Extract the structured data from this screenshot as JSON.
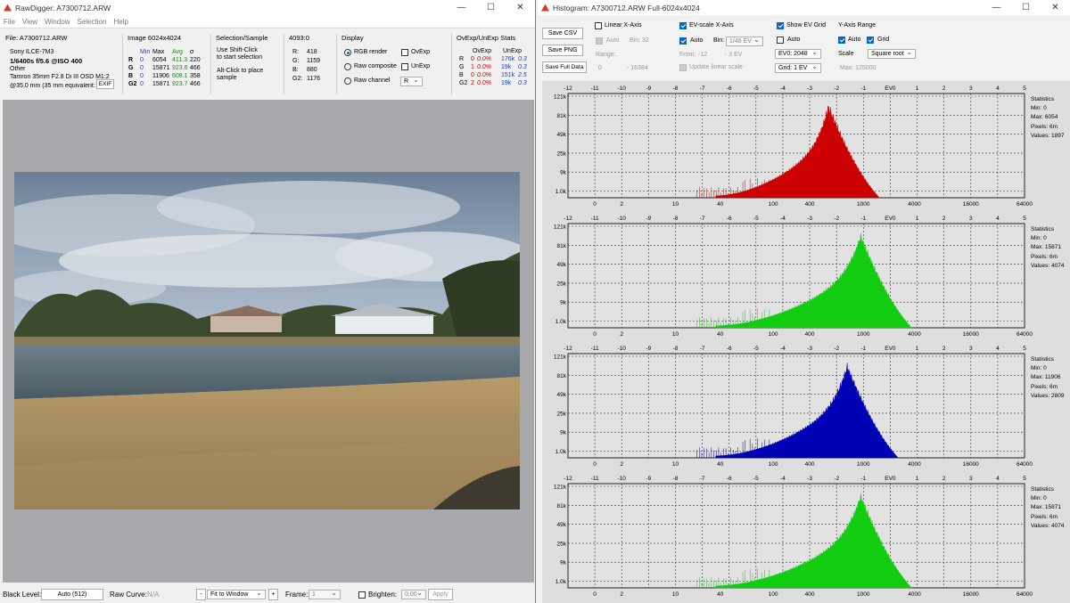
{
  "left_window": {
    "title": "RawDigger: A7300712.ARW",
    "menu": [
      "File",
      "View",
      "Window",
      "Selection",
      "Help"
    ],
    "file": {
      "label": "File: A7300712.ARW",
      "camera": "Sony ILCE-7M3",
      "exposure": "1/6400s f/5.6 @ISO 400",
      "mode": "Other",
      "lens": "Tamron 35mm F2.8 Di III OSD M1:2",
      "focal": "@35.0 mm (35 mm equivalent: ",
      "exif_button": "EXIF"
    },
    "image": {
      "label": "Image 6024x4024",
      "headers": [
        "Min",
        "Max",
        "Avg",
        "σ"
      ],
      "rows": [
        {
          "ch": "R",
          "min": "0",
          "max": "6054",
          "avg": "411.3",
          "sd": "220"
        },
        {
          "ch": "G",
          "min": "0",
          "max": "15871",
          "avg": "923.6",
          "sd": "466"
        },
        {
          "ch": "B",
          "min": "0",
          "max": "11906",
          "avg": "608.1",
          "sd": "358"
        },
        {
          "ch": "G2",
          "min": "0",
          "max": "15871",
          "avg": "923.7",
          "sd": "466"
        }
      ]
    },
    "selection": {
      "label": "Selection/Sample",
      "line1": "Use Shift-Click",
      "line2": "to start selection",
      "line3": "Alt-Click to place",
      "line4": "sample"
    },
    "coords": {
      "label": "4093:0",
      "rows": [
        {
          "ch": "R:",
          "v": "418"
        },
        {
          "ch": "G:",
          "v": "1159"
        },
        {
          "ch": "B:",
          "v": "880"
        },
        {
          "ch": "G2:",
          "v": "1176"
        }
      ]
    },
    "display": {
      "label": "Display",
      "rgb_render": "RGB render",
      "raw_composite": "Raw composite",
      "raw_channel": "Raw channel",
      "ovexp": "OvExp",
      "unexp": "UnExp",
      "channel_value": "R"
    },
    "ovstats": {
      "label": "OvExp/UnExp Stats",
      "headers": [
        "OvExp",
        "UnExp"
      ],
      "rows": [
        {
          "ch": "R",
          "n": "0",
          "pct": "0.0%",
          "un": "176k",
          "unp": "0.3"
        },
        {
          "ch": "G",
          "n": "1",
          "pct": "0.0%",
          "un": "19k",
          "unp": "0.3"
        },
        {
          "ch": "B",
          "n": "0",
          "pct": "0.0%",
          "un": "151k",
          "unp": "2.5"
        },
        {
          "ch": "G2",
          "n": "2",
          "pct": "0.0%",
          "un": "19k",
          "unp": "0.3"
        }
      ]
    },
    "status": {
      "black_level_label": "Black Level:",
      "black_level_value": "Auto (512)",
      "raw_curve_label": "Raw Curve:",
      "raw_curve_value": "N/A",
      "minus": "-",
      "zoom": "Fit to Window",
      "plus": "+",
      "frame_label": "Frame:",
      "frame_value": "1",
      "brighten_label": "Brighten:",
      "brighten_value": "0.00",
      "apply": "Apply"
    }
  },
  "right_window": {
    "title": "Histogram: A7300712.ARW Full-6024x4024",
    "buttons": {
      "save_csv": "Save CSV",
      "save_png": "Save PNG",
      "save_full": "Save Full Data"
    },
    "linear": {
      "label": "Linear X-Axis",
      "auto": "Auto",
      "bin": "Bin: 32",
      "range": "Range:",
      "from": "0",
      "to": "- 16384"
    },
    "evscale": {
      "label": "EV-scale X-Axis",
      "auto": "Auto",
      "bin_label": "Bin:",
      "bin_value": "1/48 EV",
      "from_label": "From:",
      "from_value": "-12",
      "to_value": "- 3 EV",
      "update": "Update linear scale"
    },
    "evgrid": {
      "label": "Show EV Grid",
      "auto": "Auto",
      "ev0": "EV0: 2048",
      "grid": "Grid: 1 EV"
    },
    "yaxis": {
      "label": "Y-Axis Range",
      "auto": "Auto",
      "grid": "Grid",
      "scale_label": "Scale",
      "scale_value": "Square root",
      "max": "Max: 125000"
    },
    "ev_ticks": [
      "-12",
      "-11",
      "-10",
      "-9",
      "-8",
      "-7",
      "-6",
      "-5",
      "-4",
      "-3",
      "-2",
      "-1",
      "EV0",
      "1",
      "2",
      "3",
      "4",
      "5"
    ],
    "lin_ticks": [
      "0",
      "2",
      "10",
      "40",
      "100",
      "400",
      "1000",
      "4000",
      "16000",
      "64000"
    ],
    "y_ticks": [
      "121k",
      "81k",
      "49k",
      "25k",
      "9k",
      "1.0k"
    ],
    "stats_title": "Statistics",
    "histograms": [
      {
        "channel": "R",
        "color": "#cc0000",
        "min": "Min: 0",
        "max": "Max: 6054",
        "pixels": "Pixels: 6m",
        "values": "Values: 1897",
        "peak_ev": -2.3
      },
      {
        "channel": "G",
        "color": "#11cc11",
        "min": "Min: 0",
        "max": "Max: 15871",
        "pixels": "Pixels: 6m",
        "values": "Values: 4074",
        "peak_ev": -1.1
      },
      {
        "channel": "B",
        "color": "#0000b4",
        "min": "Min: 0",
        "max": "Max: 11906",
        "pixels": "Pixels: 6m",
        "values": "Values: 2809",
        "peak_ev": -1.6
      },
      {
        "channel": "G2",
        "color": "#11cc11",
        "min": "Min: 0",
        "max": "Max: 15871",
        "pixels": "Pixels: 6m",
        "values": "Values: 4074",
        "peak_ev": -1.1
      }
    ]
  }
}
